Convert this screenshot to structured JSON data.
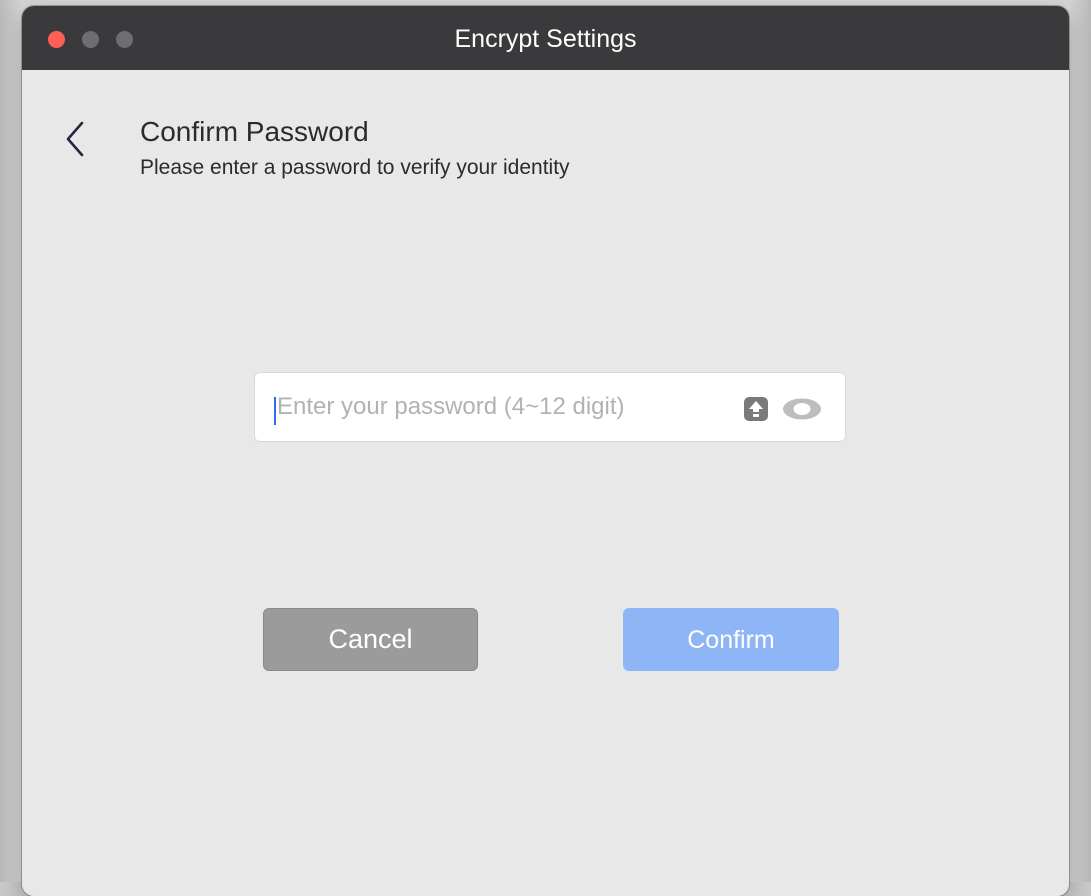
{
  "window": {
    "title": "Encrypt Settings"
  },
  "page": {
    "heading": "Confirm Password",
    "subheading": "Please enter a password to verify your identity"
  },
  "password_field": {
    "value": "",
    "placeholder": "Enter your password (4~12 digit)",
    "caps_lock_icon": "caps-lock-icon",
    "visibility_icon": "eye-icon"
  },
  "buttons": {
    "cancel_label": "Cancel",
    "confirm_label": "Confirm"
  },
  "icons": {
    "back": "chevron-left-icon"
  },
  "colors": {
    "titlebar": "#3a3a3c",
    "close": "#fe5f57",
    "traffic_inactive": "#6e6e70",
    "background": "#e8e8e8",
    "cancel": "#9b9b9b",
    "confirm": "#8eb5f6",
    "caret": "#2f6cf6"
  }
}
